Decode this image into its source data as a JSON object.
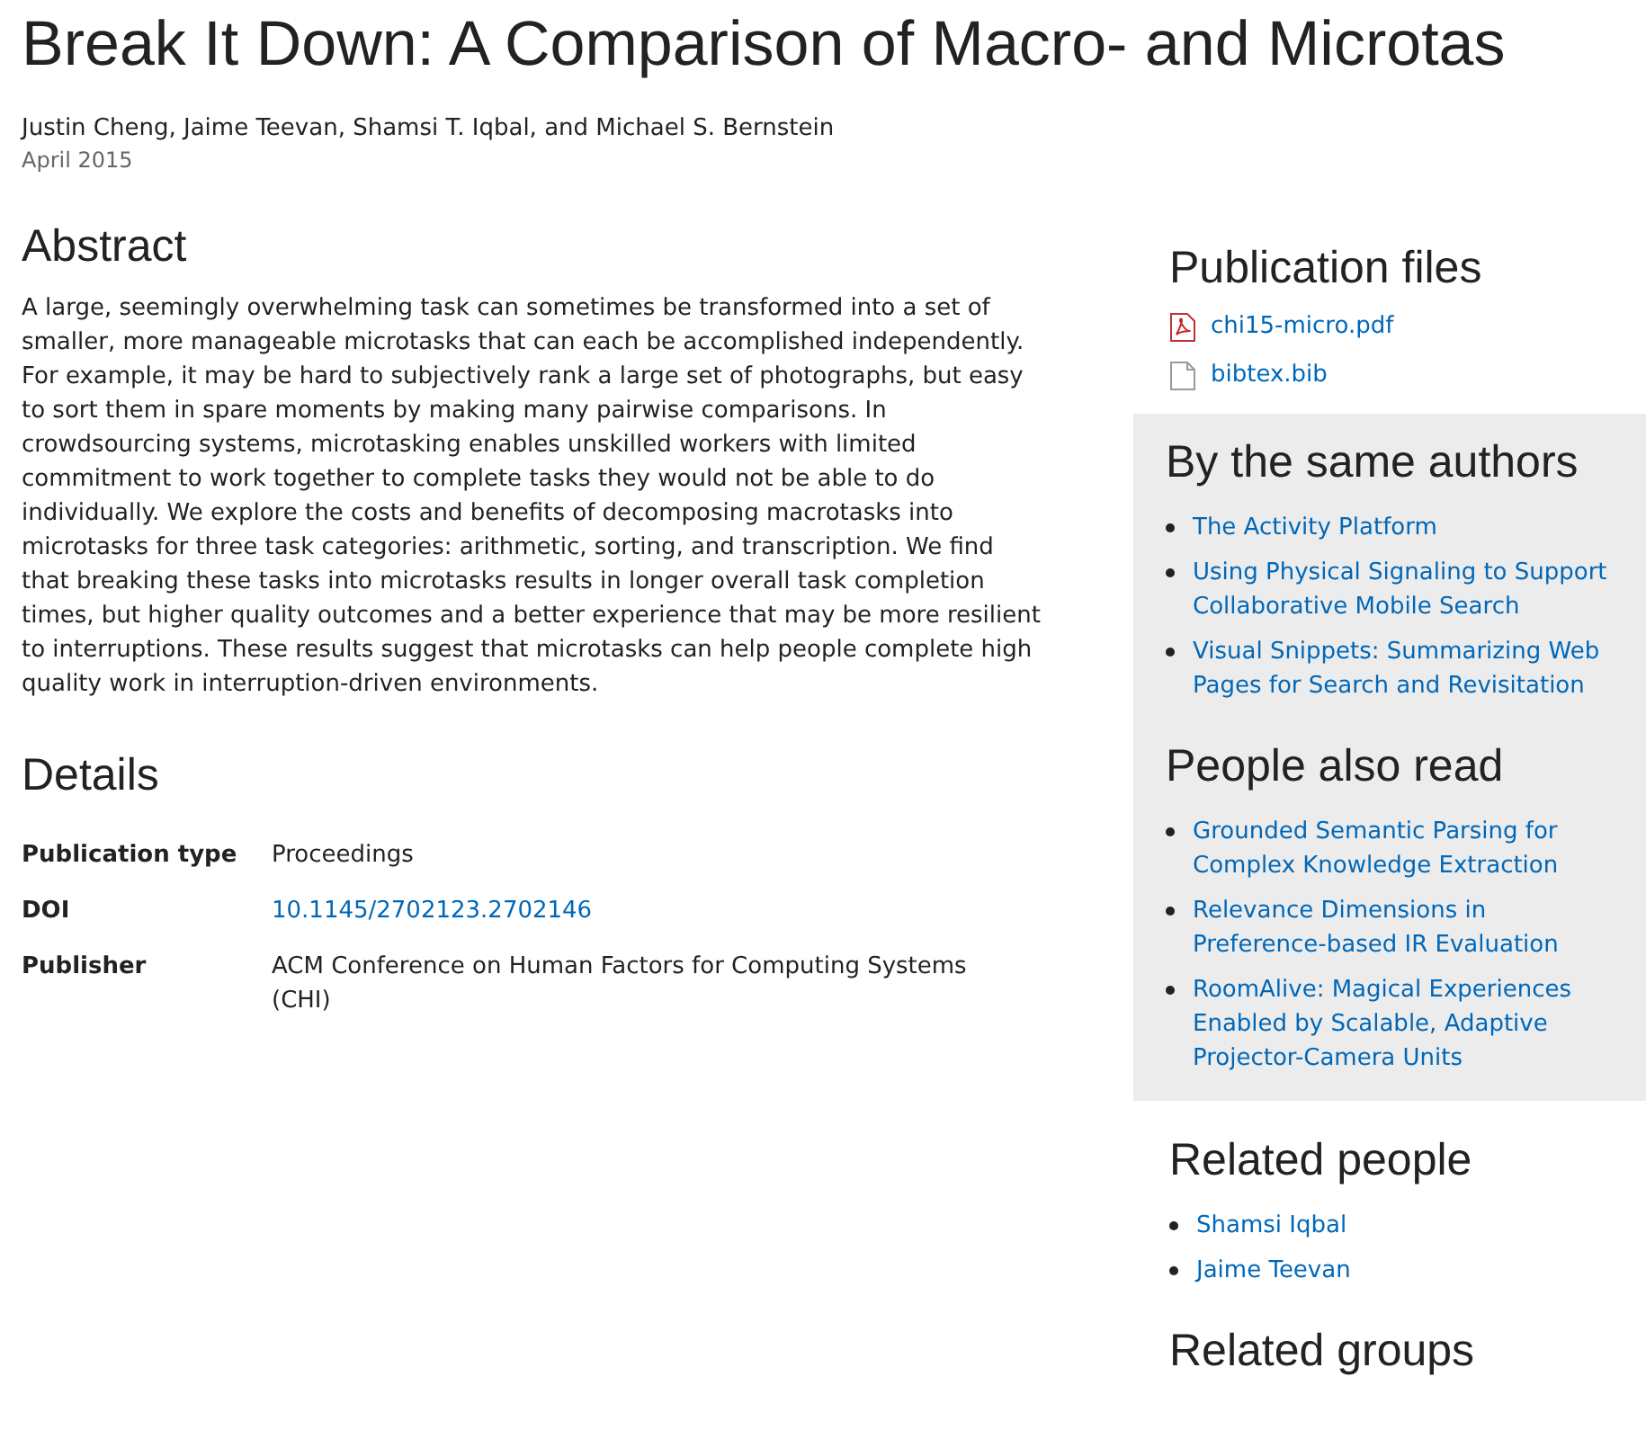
{
  "title": "Break It Down: A Comparison of Macro- and Microtas",
  "authors": "Justin Cheng, Jaime Teevan, Shamsi T. Iqbal, and Michael S. Bernstein",
  "date": "April 2015",
  "abstract": {
    "heading": "Abstract",
    "text": "A large, seemingly overwhelming task can sometimes be transformed into a set of smaller, more manageable microtasks that can each be accomplished independently. For example, it may be hard to subjectively rank a large set of photographs, but easy to sort them in spare moments by making many pairwise comparisons. In crowdsourcing systems, microtasking enables unskilled workers with limited commitment to work together to complete tasks they would not be able to do individually. We explore the costs and benefits of decomposing macrotasks into microtasks for three task categories: arithmetic, sorting, and transcription. We find that breaking these tasks into microtasks results in longer overall task completion times, but higher quality outcomes and a better experience that may be more resilient to interruptions. These results suggest that microtasks can help people complete high quality work in interruption-driven environments."
  },
  "details": {
    "heading": "Details",
    "rows": [
      {
        "label": "Publication type",
        "value": "Proceedings",
        "kind": "text"
      },
      {
        "label": "DOI",
        "value": "10.1145/2702123.2702146",
        "kind": "link"
      },
      {
        "label": "Publisher",
        "value": "ACM Conference on Human Factors for Computing Systems (CHI)",
        "kind": "text"
      }
    ]
  },
  "files": {
    "heading": "Publication files",
    "items": [
      {
        "name": "chi15-micro.pdf",
        "kind": "pdf"
      },
      {
        "name": "bibtex.bib",
        "kind": "file"
      }
    ]
  },
  "same_authors": {
    "heading": "By the same authors",
    "items": [
      "The Activity Platform",
      "Using Physical Signaling to Support Collaborative Mobile Search",
      "Visual Snippets: Summarizing Web Pages for Search and Revisitation"
    ]
  },
  "also_read": {
    "heading": "People also read",
    "items": [
      "Grounded Semantic Parsing for Complex Knowledge Extraction",
      "Relevance Dimensions in Preference-based IR Evaluation",
      "RoomAlive: Magical Experiences Enabled by Scalable, Adaptive Projector-Camera Units"
    ]
  },
  "related_people": {
    "heading": "Related people",
    "items": [
      "Shamsi Iqbal",
      "Jaime Teevan"
    ]
  },
  "related_groups": {
    "heading": "Related groups"
  }
}
